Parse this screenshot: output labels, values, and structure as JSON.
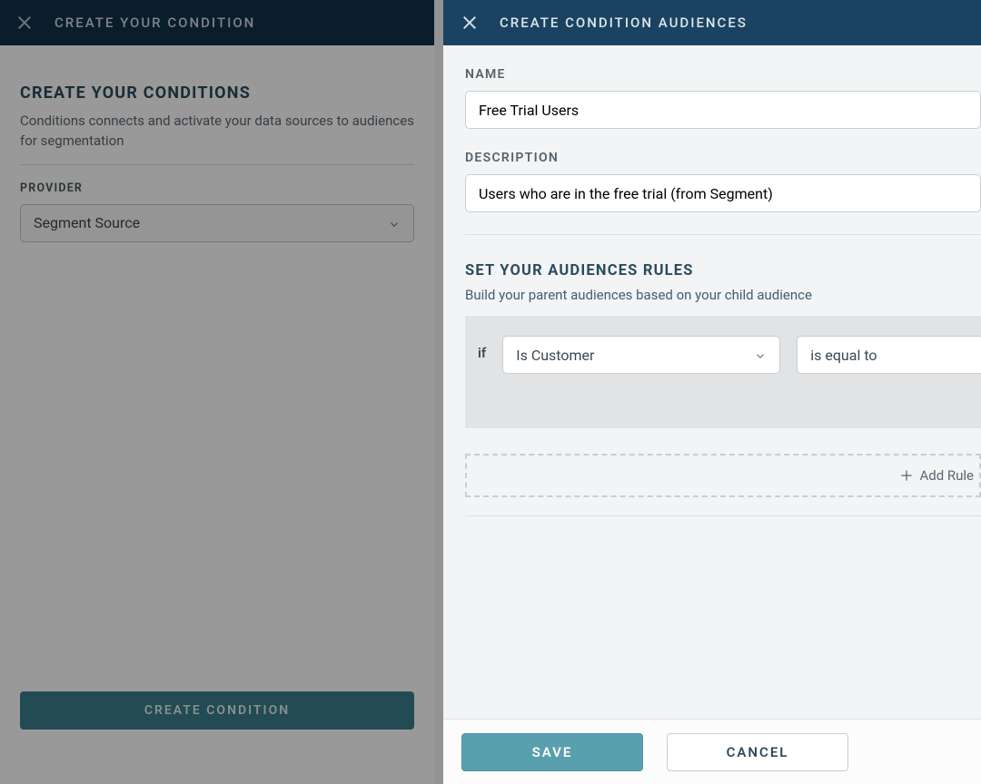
{
  "left": {
    "header_title": "CREATE YOUR CONDITION",
    "body_title": "CREATE YOUR CONDITIONS",
    "body_subtitle": "Conditions connects and activate your data sources to audiences for segmentation",
    "provider_label": "PROVIDER",
    "provider_value": "Segment Source",
    "create_button": "CREATE CONDITION"
  },
  "right": {
    "header_title": "CREATE CONDITION AUDIENCES",
    "name_label": "NAME",
    "name_value": "Free Trial Users",
    "description_label": "DESCRIPTION",
    "description_value": "Users who are in the free trial (from Segment)",
    "rules_title": "SET YOUR AUDIENCES RULES",
    "rules_subtitle": "Build your parent audiences based on your child audience",
    "rule": {
      "if_label": "if",
      "field": "Is Customer",
      "operator": "is equal to"
    },
    "add_rule_label": "Add Rule",
    "footer": {
      "save": "SAVE",
      "cancel": "CANCEL"
    }
  }
}
